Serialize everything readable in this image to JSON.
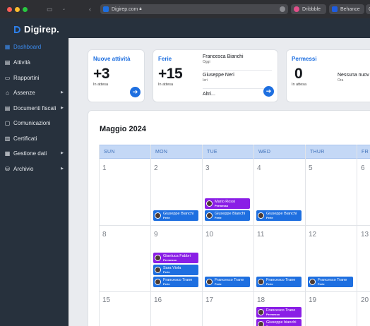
{
  "browser": {
    "url": "Digirep.com",
    "lock_icon": "lock-icon",
    "tabs": [
      "Dribbble",
      "Behance",
      "G"
    ]
  },
  "app": {
    "name": "Digirep."
  },
  "sidebar": {
    "items": [
      {
        "label": "Dashboard",
        "icon": "grid-icon",
        "active": true
      },
      {
        "label": "Attività",
        "icon": "clipboard-icon"
      },
      {
        "label": "Rapportini",
        "icon": "folder-icon"
      },
      {
        "label": "Assenze",
        "icon": "home-icon",
        "caret": true
      },
      {
        "label": "Documenti fiscali",
        "icon": "document-icon",
        "caret": true
      },
      {
        "label": "Comunicazioni",
        "icon": "chat-icon"
      },
      {
        "label": "Certificati",
        "icon": "certificate-icon"
      },
      {
        "label": "Gestione dati",
        "icon": "table-icon",
        "caret": true
      },
      {
        "label": "Archivio",
        "icon": "archive-icon",
        "caret": true
      }
    ]
  },
  "cards": {
    "nuove": {
      "title": "Nuove attività",
      "value": "+3",
      "sub": "In attesa"
    },
    "ferie": {
      "title": "Ferie",
      "value": "+15",
      "sub": "In attesa",
      "rows": [
        {
          "name": "Francesca Bianchi",
          "when": "Oggi"
        },
        {
          "name": "Giuseppe Neri",
          "when": "Ieri"
        }
      ],
      "more": "Altri..."
    },
    "permessi": {
      "title": "Permessi",
      "value": "0",
      "sub": "In attesa",
      "row_name": "Nessuna nuov",
      "row_when": "Ora"
    }
  },
  "calendar": {
    "title": "Maggio 2024",
    "days": [
      "SUN",
      "MON",
      "TUE",
      "WED",
      "THUR",
      "FR"
    ],
    "weeks": [
      [
        "1",
        "2",
        "3",
        "4",
        "5",
        "6"
      ],
      [
        "8",
        "9",
        "10",
        "11",
        "12",
        "13"
      ],
      [
        "15",
        "16",
        "17",
        "18",
        "19",
        "20"
      ]
    ],
    "events": {
      "w1_mon_1": {
        "name": "Giuseppe Bianchi",
        "kind": "Ferie"
      },
      "w1_tue_1": {
        "name": "Mario Rossi",
        "kind": "Permesso"
      },
      "w1_tue_2": {
        "name": "Giuseppe Bianchi",
        "kind": "Ferie"
      },
      "w1_wed_1": {
        "name": "Giuseppe Bianchi",
        "kind": "Ferie"
      },
      "w2_mon_1": {
        "name": "Gianluca Fabbri",
        "kind": "Permesso"
      },
      "w2_mon_2": {
        "name": "Sara Viola",
        "kind": "Ferie"
      },
      "w2_mon_3": {
        "name": "Francesco Trane",
        "kind": "Ferie"
      },
      "w2_tue_1": {
        "name": "Francesco Trane",
        "kind": "Ferie"
      },
      "w2_wed_1": {
        "name": "Francesco Trane",
        "kind": "Ferie"
      },
      "w2_thu_1": {
        "name": "Francesco Trane",
        "kind": "Ferie"
      },
      "w3_wed_1": {
        "name": "Francesco Trane",
        "kind": "Permesso"
      },
      "w3_wed_2": {
        "name": "Giuseppe bianchi",
        "kind": "Permesso"
      }
    }
  },
  "colors": {
    "accent": "#1e6fe0",
    "purple": "#8a1ee6",
    "sidebar": "#27313d"
  }
}
